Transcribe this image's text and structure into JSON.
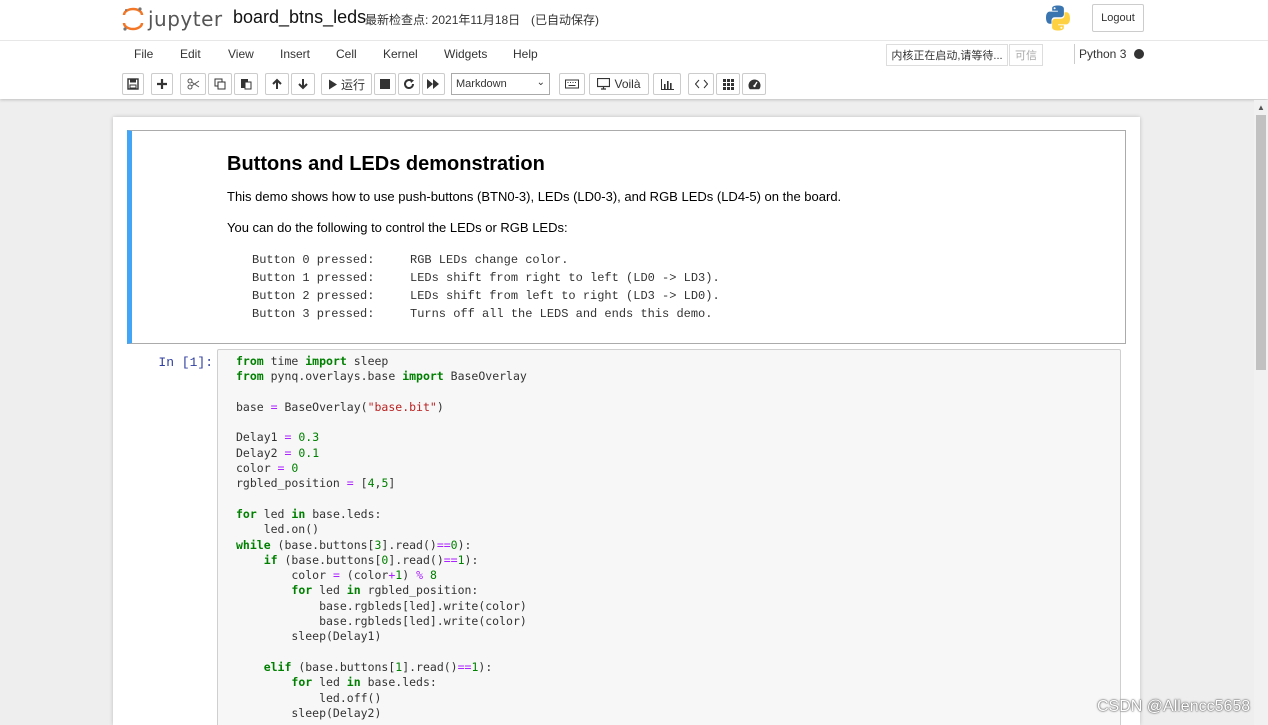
{
  "header": {
    "logo_text": "jupyter",
    "notebook_name": "board_btns_leds",
    "checkpoint": "最新检查点: 2021年11月18日",
    "autosave": "(已自动保存)",
    "logout_label": "Logout"
  },
  "menubar": {
    "items": [
      "File",
      "Edit",
      "View",
      "Insert",
      "Cell",
      "Kernel",
      "Widgets",
      "Help"
    ],
    "kernel_status": "内核正在启动,请等待...",
    "trusted": "可信",
    "kernel_name": "Python 3"
  },
  "toolbar": {
    "run_label": "运行",
    "cell_type": "Markdown",
    "voila_label": "Voilà"
  },
  "markdown_cell": {
    "title": "Buttons and LEDs demonstration",
    "p1": "This demo shows how to use push-buttons (BTN0-3), LEDs (LD0-3), and RGB LEDs (LD4-5) on the board.",
    "p2": "You can do the following to control the LEDs or RGB LEDs:",
    "rows": [
      {
        "button": "Button 0 pressed:",
        "action": "RGB LEDs change color."
      },
      {
        "button": "Button 1 pressed:",
        "action": "LEDs shift from right to left (LD0 -> LD3)."
      },
      {
        "button": "Button 2 pressed:",
        "action": "LEDs shift from left to right (LD3 -> LD0)."
      },
      {
        "button": "Button 3 pressed:",
        "action": "Turns off all the LEDS and ends this demo."
      }
    ]
  },
  "code_cell": {
    "prompt": "In  [1]:"
  },
  "watermark": "CSDN @Allencc5658"
}
